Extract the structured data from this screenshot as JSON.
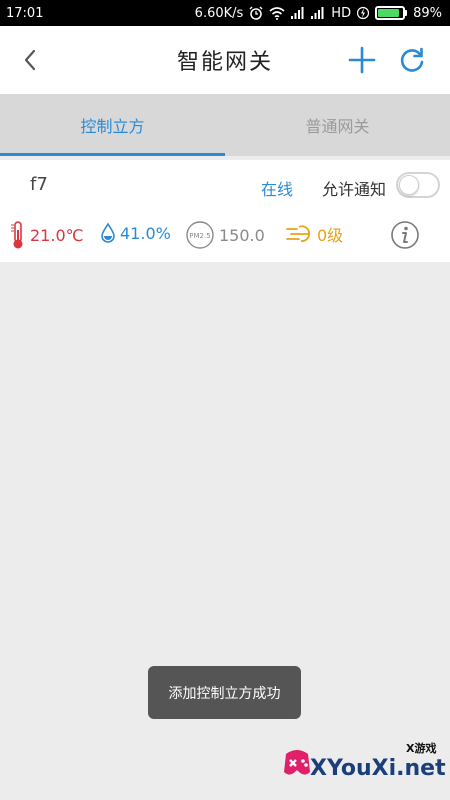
{
  "status_bar": {
    "time": "17:01",
    "speed": "6.60K/s",
    "network": "HD",
    "battery": "89%",
    "battery_level": 0.89
  },
  "header": {
    "title": "智能网关",
    "back_icon": "chevron-left-icon",
    "add_icon": "plus-icon",
    "refresh_icon": "refresh-icon",
    "accent": "#2b8ad8"
  },
  "tabs": [
    {
      "label": "控制立方",
      "active": true
    },
    {
      "label": "普通网关",
      "active": false
    }
  ],
  "device": {
    "name": "f7",
    "status": "在线",
    "notify_label": "允许通知",
    "notify_enabled": false,
    "temperature": "21.0℃",
    "humidity": "41.0%",
    "pm25_icon_label": "PM2.5",
    "pm25": "150.0",
    "wind": "0级",
    "colors": {
      "temperature": "#d9363e",
      "humidity": "#2b8ad8",
      "pm25": "#8a8a8a",
      "wind": "#e8a317"
    }
  },
  "toast": {
    "message": "添加控制立方成功"
  },
  "watermark": {
    "text": "XYouXi.net",
    "small": "X游戏"
  }
}
